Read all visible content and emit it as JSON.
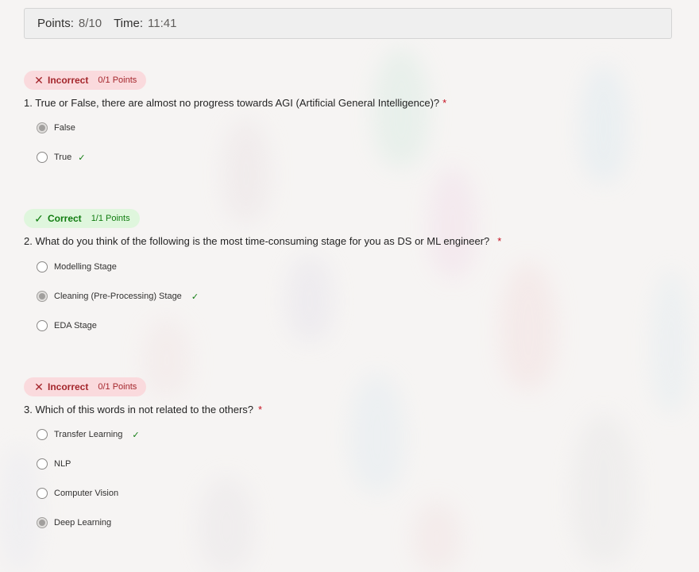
{
  "header": {
    "points_label": "Points:",
    "points_value": "8/10",
    "time_label": "Time:",
    "time_value": "11:41"
  },
  "questions": [
    {
      "status": "Incorrect",
      "mark": "✕",
      "points": "0/1 Points",
      "text": "1. True or False, there are almost no progress towards AGI (Artificial General Intelligence)?",
      "required": "*",
      "options": [
        {
          "label": "False",
          "selected": true,
          "correct": false
        },
        {
          "label": "True",
          "selected": false,
          "correct": true,
          "check": "✓"
        }
      ]
    },
    {
      "status": "Correct",
      "mark": "✓",
      "points": "1/1 Points",
      "text": "2. What do you think of the following is the most time-consuming stage for you as DS or ML engineer?",
      "required": "*",
      "options": [
        {
          "label": "Modelling Stage",
          "selected": false,
          "correct": false
        },
        {
          "label": "Cleaning (Pre-Processing) Stage",
          "selected": true,
          "correct": true,
          "check": "✓"
        },
        {
          "label": "EDA Stage",
          "selected": false,
          "correct": false
        }
      ]
    },
    {
      "status": "Incorrect",
      "mark": "✕",
      "points": "0/1 Points",
      "text": "3. Which of this words in not related to the others?",
      "required": "*",
      "options": [
        {
          "label": "Transfer Learning",
          "selected": false,
          "correct": true,
          "check": "✓"
        },
        {
          "label": "NLP",
          "selected": false,
          "correct": false
        },
        {
          "label": "Computer Vision",
          "selected": false,
          "correct": false
        },
        {
          "label": "Deep Learning",
          "selected": true,
          "correct": false
        }
      ]
    }
  ]
}
